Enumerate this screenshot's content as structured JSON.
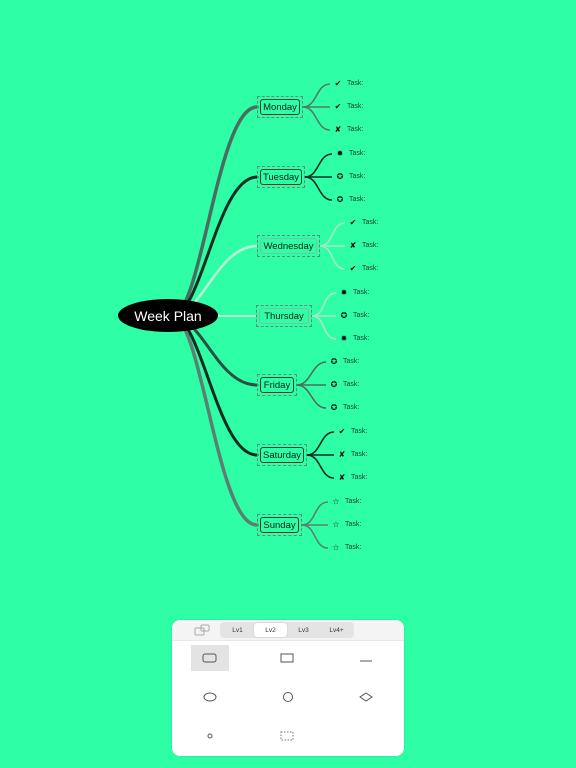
{
  "mindmap": {
    "root": "Week Plan",
    "days": [
      {
        "label": "Monday",
        "tasks": [
          {
            "icon": "check",
            "label": "Task:"
          },
          {
            "icon": "check",
            "label": "Task:"
          },
          {
            "icon": "cross",
            "label": "Task:"
          }
        ]
      },
      {
        "label": "Tuesday",
        "tasks": [
          {
            "icon": "dot-filled",
            "label": "Task:"
          },
          {
            "icon": "dot-open",
            "label": "Task:"
          },
          {
            "icon": "dot-open",
            "label": "Task:"
          }
        ]
      },
      {
        "label": "Wednesday",
        "tasks": [
          {
            "icon": "check",
            "label": "Task:"
          },
          {
            "icon": "cross",
            "label": "Task:"
          },
          {
            "icon": "check",
            "label": "Task:"
          }
        ]
      },
      {
        "label": "Thursday",
        "tasks": [
          {
            "icon": "dot-filled",
            "label": "Task:"
          },
          {
            "icon": "dot-open",
            "label": "Task:"
          },
          {
            "icon": "dot-filled",
            "label": "Task:"
          }
        ]
      },
      {
        "label": "Friday",
        "tasks": [
          {
            "icon": "dot-open",
            "label": "Task:"
          },
          {
            "icon": "dot-open",
            "label": "Task:"
          },
          {
            "icon": "dot-open",
            "label": "Task:"
          }
        ]
      },
      {
        "label": "Saturday",
        "tasks": [
          {
            "icon": "check",
            "label": "Task:"
          },
          {
            "icon": "cross",
            "label": "Task:"
          },
          {
            "icon": "cross",
            "label": "Task:"
          }
        ]
      },
      {
        "label": "Sunday",
        "tasks": [
          {
            "icon": "star",
            "label": "Task:"
          },
          {
            "icon": "star",
            "label": "Task:"
          },
          {
            "icon": "star",
            "label": "Task:"
          }
        ]
      }
    ]
  },
  "panel": {
    "tabs": [
      "Lv1",
      "Lv2",
      "Lv3",
      "Lv4+"
    ],
    "active_tab": "Lv2",
    "shapes": [
      "rounded-rect",
      "rect",
      "underline",
      "ellipse",
      "circle",
      "diamond",
      "small-circle",
      "dashed-rect"
    ],
    "selected_shape": "rounded-rect"
  },
  "colors": {
    "background": "#2effa6",
    "root_fill": "#000000",
    "root_text": "#ffffff"
  }
}
